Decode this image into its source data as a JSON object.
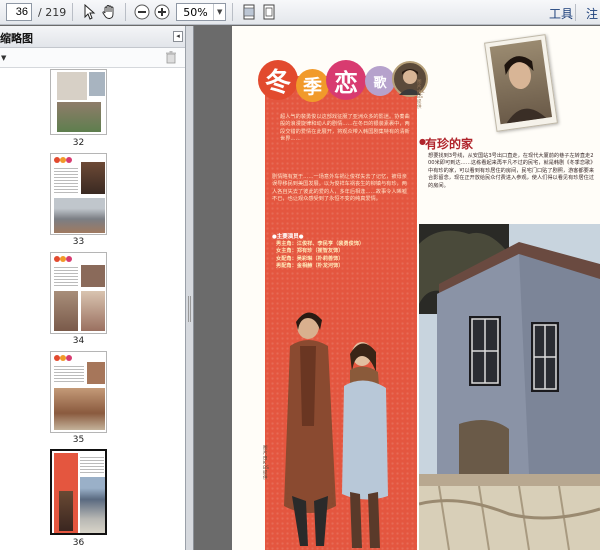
{
  "toolbar": {
    "current_page": "36",
    "total_pages": "/ 219",
    "zoom": "50%",
    "tools_label": "工具",
    "notes_label": "注"
  },
  "sidebar": {
    "title": "缩略图",
    "collapse_symbol": "◂",
    "thumbnails": [
      {
        "page": "32"
      },
      {
        "page": "33"
      },
      {
        "page": "34"
      },
      {
        "page": "35"
      },
      {
        "page": "36"
      }
    ]
  },
  "page": {
    "title_chars": [
      "冬",
      "季",
      "恋",
      "歌"
    ],
    "intro": "超人气的裴勇俊以这部戏征服了亚洲众多的影迷。协奏曲般的浪漫旋律和动人的剧情……在冬日的银装素裹中，两段交错的爱情在此展开，将观众带入韩国剧集特有的清新世界……",
    "intro2": "剧情略有复于……一场意外车祸让俊祥失去了记忆，被母亲误导移民到美国发展。以为俊祥车祸丧生的柳镇与有珍，两人各自失去了彼此的爱的人，多年后相逢……故事令人唏嘘不已，也让观众感受到了永恒不变的纯真爱情。",
    "cast_title": "●主要演员●",
    "cast": [
      "男主角：江俊祥、李民亨（裴勇俊饰）",
      "女主角：郑有珍（崔智友饰）",
      "女配角：吴彩琳（朴莉善饰）",
      "男配角：金相赫（朴龙河饰）"
    ],
    "section_title": "有珍的家",
    "section_body": "想要找到3号线，从安国站3号出口直走，在现代大厦前的巷子左转直走200米即可到达……这栋看起来再平凡不过的民宅，就是韩剧《冬季恋歌》中有珍的家，可以看到有珍居住的房间，民宅门口贴了剧照，游客都要来合影留念，现在正开放给民众付费进入参观，使人们得以看见有珍居住过的房间。",
    "section_highlight": "《冬季恋歌》",
    "photo_caption": "图片由KBS提供"
  }
}
